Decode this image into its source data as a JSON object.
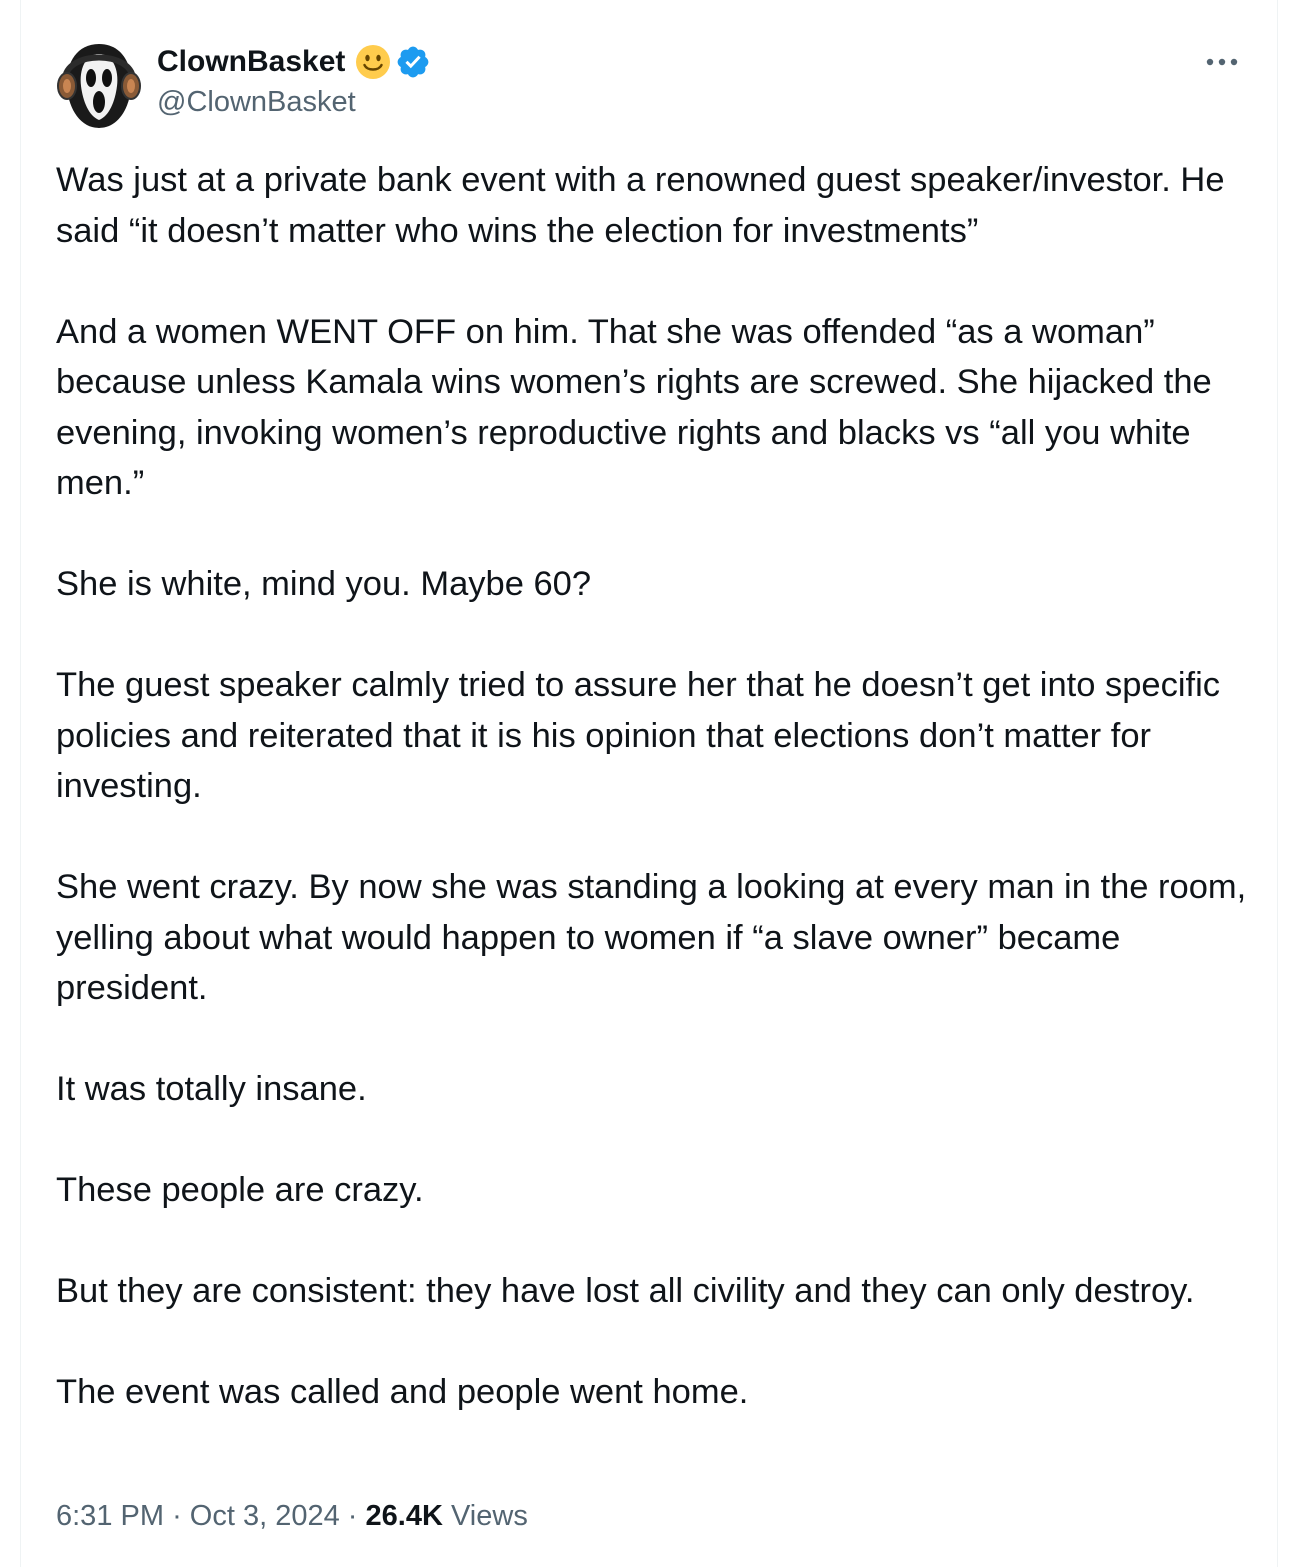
{
  "author": {
    "display_name": "ClownBasket",
    "handle": "@ClownBasket",
    "emoji": "smiley-face-emoji",
    "verified": true,
    "verified_color": "#1d9bf0",
    "avatar_icon": "ghostface-headphones-avatar"
  },
  "post": {
    "paragraphs": [
      "Was just at a private bank event with a renowned guest speaker/investor. He said “it doesn’t matter who wins the election for investments”",
      "And a women WENT OFF on him. That she was offended “as a woman” because unless Kamala wins women’s rights are screwed. She hijacked the evening, invoking women’s reproductive rights and blacks vs “all you white men.”",
      "She is white, mind you. Maybe 60?",
      "The guest speaker calmly tried to assure her that he doesn’t get into specific policies and reiterated that it is his opinion that elections don’t matter for investing.",
      "She went crazy. By now she was standing a looking at every man in the room, yelling about what would happen to women if “a slave owner” became president.",
      "It was totally insane.",
      "These people are crazy.",
      "But they are consistent: they have lost all civility and they can only destroy.",
      "The event was called and people went home."
    ]
  },
  "meta": {
    "time": "6:31 PM",
    "separator": "·",
    "date": "Oct 3, 2024",
    "views_count": "26.4K",
    "views_label": "Views"
  },
  "colors": {
    "text": "#0f1419",
    "secondary": "#536471",
    "border": "#eff3f4"
  }
}
